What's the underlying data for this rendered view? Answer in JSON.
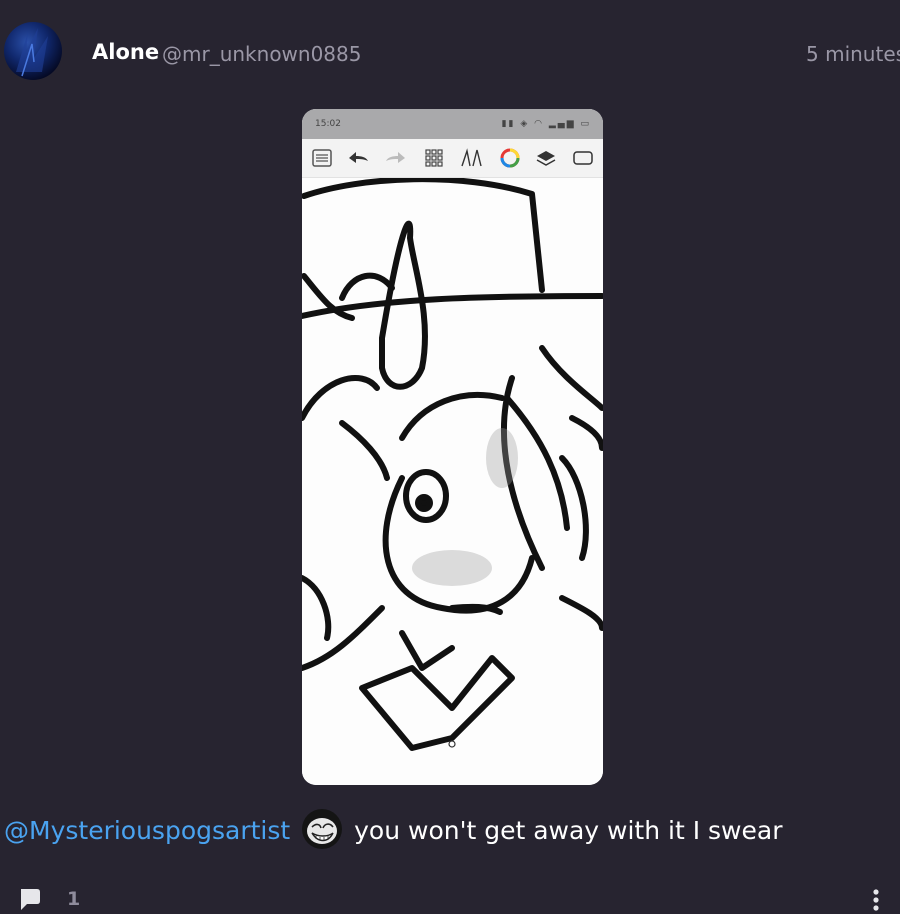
{
  "post": {
    "author_name": "Alone",
    "author_handle": "@mr_unknown0885",
    "timestamp": "5 minutes",
    "caption_mention": "@Mysteriouspogsartist",
    "caption_text": "you won't get away with it I swear",
    "comment_count": "1"
  },
  "screenshot": {
    "status_time": "15:02",
    "toolbar_icons": [
      "list-icon",
      "undo-icon",
      "redo-icon",
      "grid-icon",
      "brush-icon",
      "color-wheel-icon",
      "layers-icon",
      "canvas-icon"
    ]
  },
  "icons": {
    "avatar": "avatar",
    "comment": "comment-icon",
    "more": "more-options-icon",
    "emoji": "trollface-emoji"
  },
  "colors": {
    "background": "#272430",
    "mention": "#4aa3f0",
    "muted_text": "#9a97a6"
  }
}
